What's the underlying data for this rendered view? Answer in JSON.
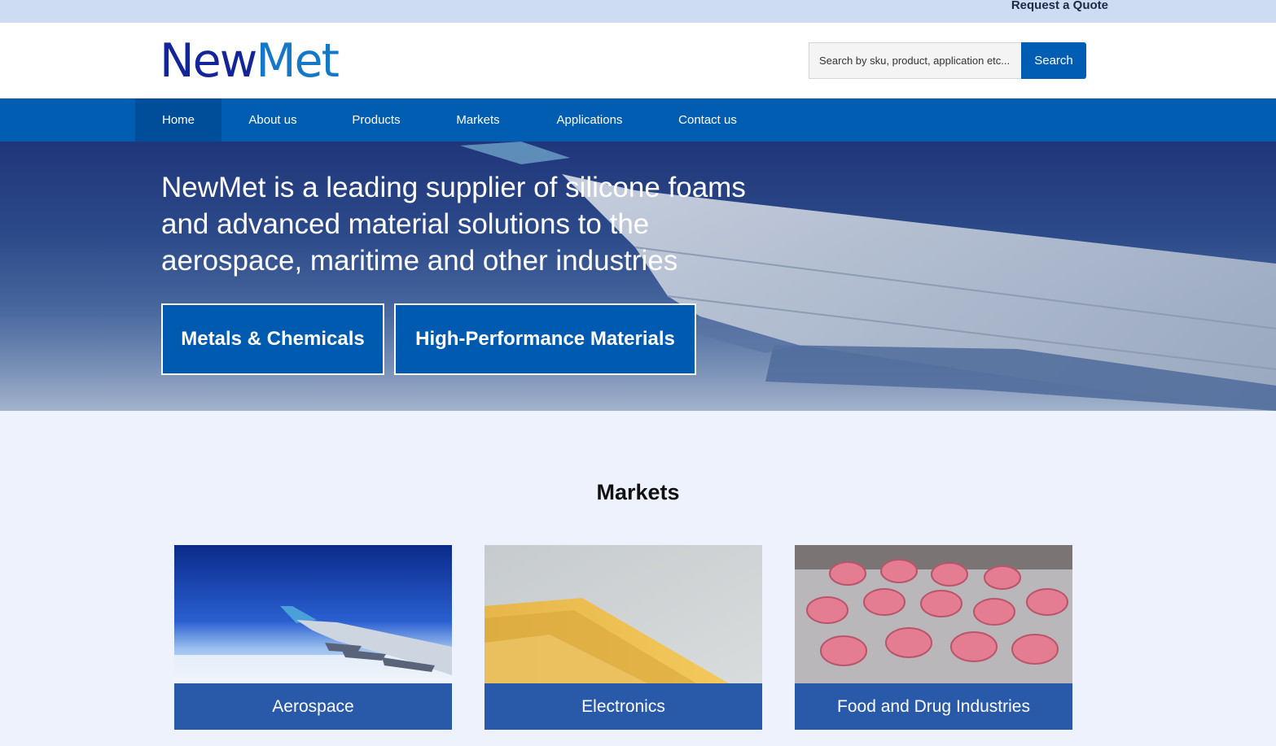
{
  "topbar": {
    "quote_label": "Request a Quote"
  },
  "brand": {
    "logo_part1": "New",
    "logo_part2": "Met"
  },
  "search": {
    "placeholder": "Search by sku, product, application etc...",
    "button_label": "Search"
  },
  "nav": {
    "items": [
      {
        "label": "Home",
        "active": true
      },
      {
        "label": "About us"
      },
      {
        "label": "Products"
      },
      {
        "label": "Markets"
      },
      {
        "label": "Applications"
      },
      {
        "label": "Contact us"
      }
    ]
  },
  "hero": {
    "headline": "NewMet is a leading supplier of silicone foams and advanced material solutions to the aerospace, maritime and other industries",
    "buttons": [
      "Metals & Chemicals",
      "High-Performance Materials"
    ]
  },
  "markets": {
    "title": "Markets",
    "cards": [
      {
        "label": "Aerospace",
        "image_icon": "airplane-wing-image"
      },
      {
        "label": "Electronics",
        "image_icon": "circuit-pins-image"
      },
      {
        "label": "Food and Drug Industries",
        "image_icon": "pill-blister-image"
      }
    ]
  },
  "colors": {
    "brand_blue": "#005db2",
    "logo_dark": "#14259a",
    "logo_light": "#1578c7",
    "card_label_bg": "#285aa9",
    "page_bg": "#edf2fd"
  }
}
